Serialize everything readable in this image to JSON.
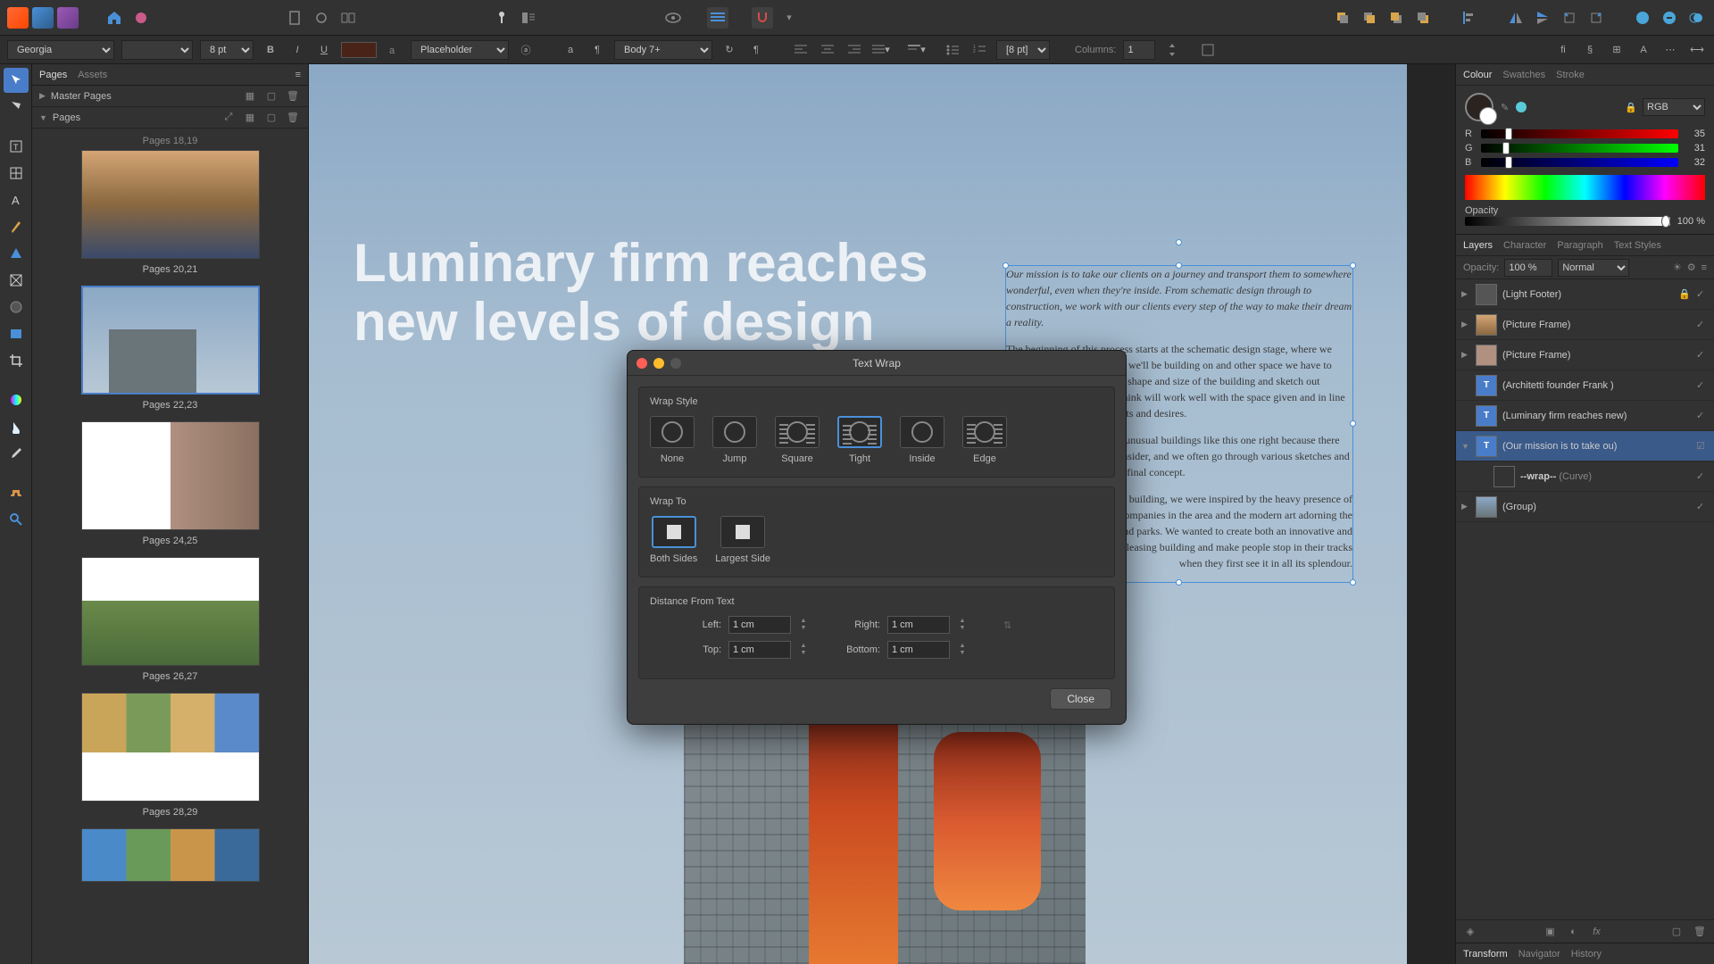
{
  "toolbar": {
    "font_family": "Georgia",
    "font_size": "8 pt",
    "para_style_label": "Placeholder",
    "text_style": "Body 7+",
    "leading": "[8 pt]",
    "columns_label": "Columns:",
    "columns_value": "1"
  },
  "pages_panel": {
    "tabs": [
      "Pages",
      "Assets"
    ],
    "master_label": "Master Pages",
    "pages_label": "Pages",
    "truncated_top": "Pages 18,19",
    "thumbs": [
      {
        "label": "Pages 20,21"
      },
      {
        "label": "Pages 22,23"
      },
      {
        "label": "Pages 24,25"
      },
      {
        "label": "Pages 26,27"
      },
      {
        "label": "Pages 28,29"
      }
    ]
  },
  "document": {
    "headline_l1": "Luminary firm reaches",
    "headline_l2": "new levels of design",
    "para1": "Our mission is to take our clients on a journey and transport them to somewhere wonderful, even when they're inside. From schematic design through to construction, we work with our clients every step of the way to make their dream a reality.",
    "para2": "The beginning of this process starts at the schematic design stage, where we analyse the property or land we'll be building on and other space we have to work with. We establish the shape and size of the building and sketch out different concepts that we think will work well with the space given and in line with our client's requirements and desires.",
    "para3": "It can be challenging to get unusual buildings like this one right because there are so many elements to consider, and we often go through various sketches and CGIs before we land on the final concept.",
    "para4": "For this building, we were inspired by the heavy presence of technology companies in the area and the modern art adorning the nearby streets and parks. We wanted to create both an innovative and aesthetically pleasing building and make people stop in their tracks when they first see it in all its splendour."
  },
  "dialog": {
    "title": "Text Wrap",
    "wrap_style_label": "Wrap Style",
    "wrap_styles": [
      "None",
      "Jump",
      "Square",
      "Tight",
      "Inside",
      "Edge"
    ],
    "wrap_to_label": "Wrap To",
    "wrap_to": [
      "Both Sides",
      "Largest Side"
    ],
    "distance_label": "Distance From Text",
    "left_label": "Left:",
    "left_value": "1 cm",
    "right_label": "Right:",
    "right_value": "1 cm",
    "top_label": "Top:",
    "top_value": "1 cm",
    "bottom_label": "Bottom:",
    "bottom_value": "1 cm",
    "close": "Close"
  },
  "color_panel": {
    "tabs": [
      "Colour",
      "Swatches",
      "Stroke"
    ],
    "mode": "RGB",
    "r": "35",
    "g": "31",
    "b": "32",
    "opacity_label": "Opacity",
    "opacity_value": "100 %"
  },
  "layers_panel": {
    "tabs": [
      "Layers",
      "Character",
      "Paragraph",
      "Text Styles"
    ],
    "opacity_label": "Opacity:",
    "opacity_value": "100 %",
    "blend_mode": "Normal",
    "layers": [
      {
        "name": "(Light Footer)",
        "type": "group",
        "locked": true
      },
      {
        "name": "(Picture Frame)",
        "type": "img"
      },
      {
        "name": "(Picture Frame)",
        "type": "img"
      },
      {
        "name": "(Architetti founder Frank )",
        "type": "text"
      },
      {
        "name": "(Luminary firm reaches new)",
        "type": "text"
      },
      {
        "name": "(Our mission is to take ou)",
        "type": "text",
        "selected": true
      },
      {
        "name": "--wrap--",
        "suffix": "(Curve)",
        "type": "curve",
        "child": true
      },
      {
        "name": "(Group)",
        "type": "group"
      }
    ]
  },
  "bottom_tabs": [
    "Transform",
    "Navigator",
    "History"
  ]
}
